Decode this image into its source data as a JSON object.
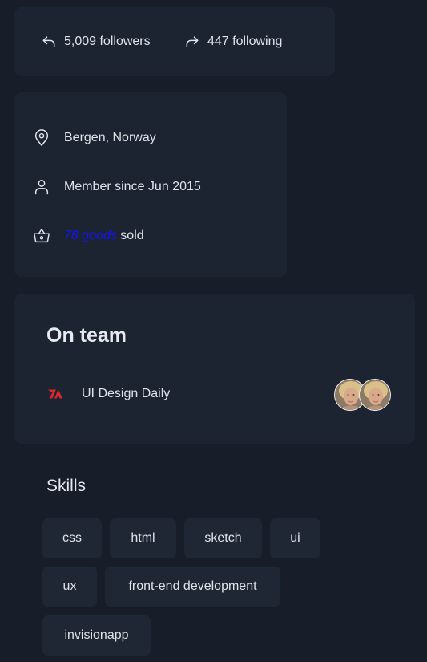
{
  "stats": {
    "followers": "5,009 followers",
    "following": "447 following"
  },
  "info": {
    "location": "Bergen, Norway",
    "member_since": "Member since Jun 2015",
    "goods_link": "78 goods",
    "goods_suffix": " sold"
  },
  "team": {
    "title": "On team",
    "name": "UI Design Daily",
    "logo_color": "#d7262e"
  },
  "skills": {
    "title": "Skills",
    "tags": [
      "css",
      "html",
      "sketch",
      "ui",
      "ux",
      "front-end development",
      "invisionapp"
    ]
  },
  "colors": {
    "background": "#171e29",
    "card": "#1c2431",
    "link": "#1414ff"
  }
}
